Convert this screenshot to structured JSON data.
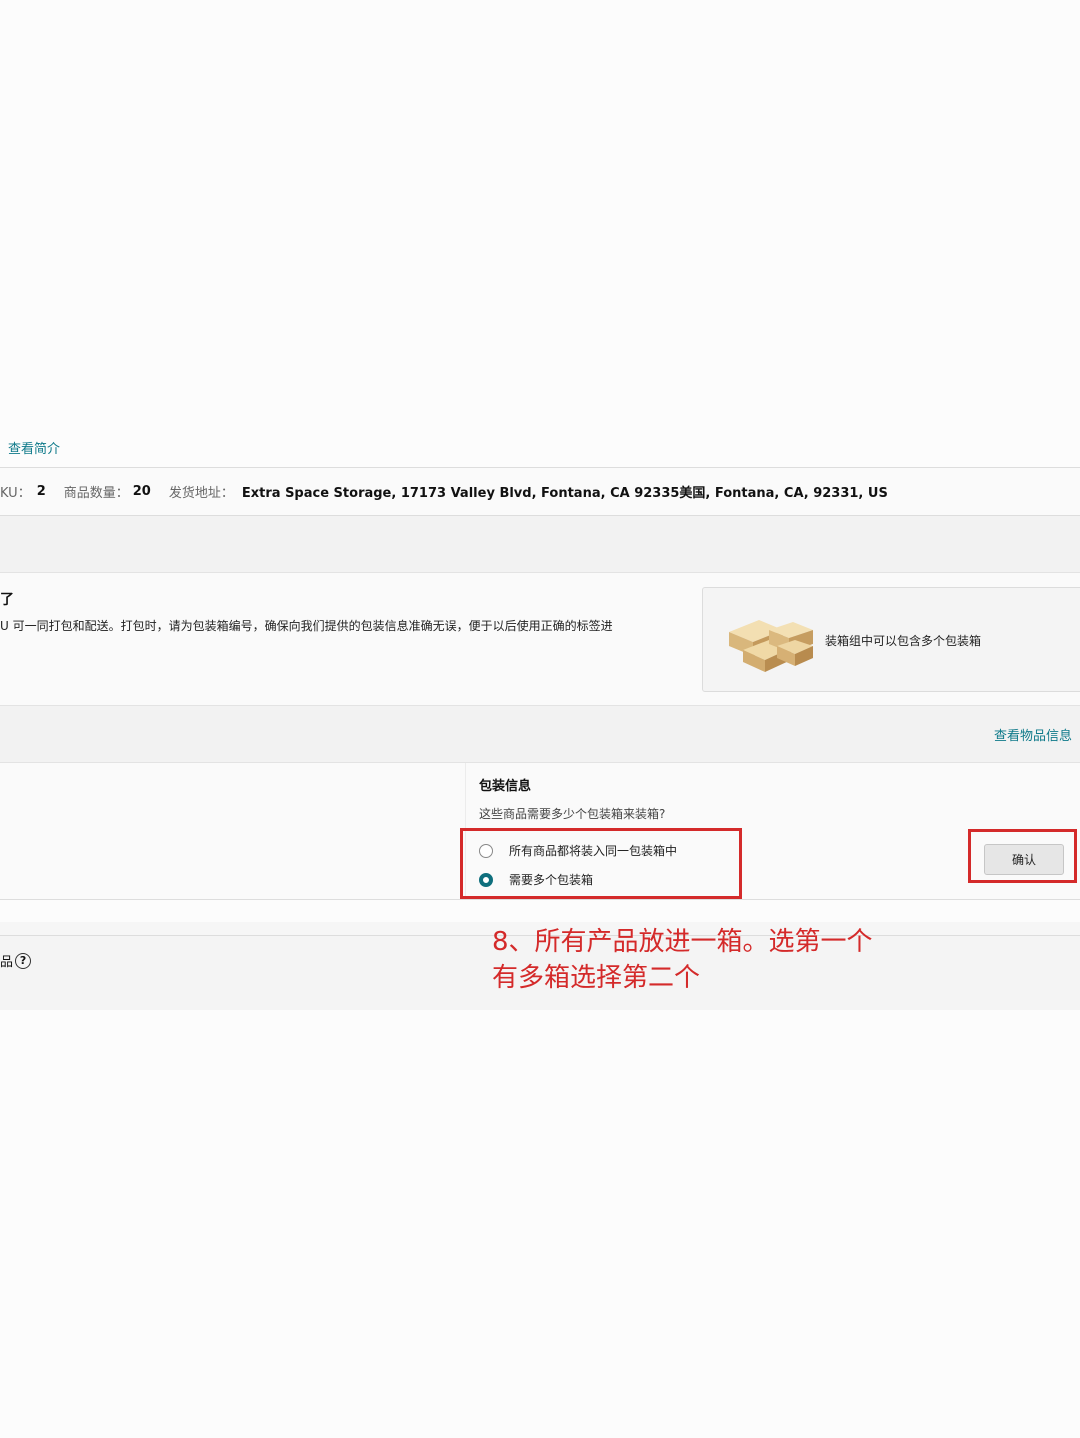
{
  "view_summary_link": "查看简介",
  "info_bar": {
    "sku_label": "KU：",
    "sku_value": "2",
    "qty_label": "商品数量：",
    "qty_value": "20",
    "address_label": "发货地址：",
    "address_value": "Extra Space Storage, 17173 Valley Blvd, Fontana, CA 92335美国, Fontana, CA, 92331, US"
  },
  "packing_intro": {
    "title": "了",
    "description": "U 可一同打包和配送。打包时，请为包装箱编号，确保向我们提供的包装信息准确无误，便于以后使用正确的标签进",
    "illustration_caption": "装箱组中可以包含多个包装箱"
  },
  "view_item_info_link": "查看物品信息",
  "packing_info": {
    "title": "包装信息",
    "question": "这些商品需要多少个包装箱来装箱?",
    "options": [
      {
        "label": "所有商品都将装入同一包装箱中",
        "selected": false
      },
      {
        "label": "需要多个包装箱",
        "selected": true
      }
    ],
    "confirm_button": "确认"
  },
  "bottom_label": "品",
  "annotation": {
    "line1": "8、所有产品放进一箱。选第一个",
    "line2": "有多箱选择第二个",
    "color": "#d42a2a"
  },
  "colors": {
    "link": "#0f7a8a",
    "radio_checked": "#0f6f7d",
    "highlight": "#d42a2a"
  }
}
